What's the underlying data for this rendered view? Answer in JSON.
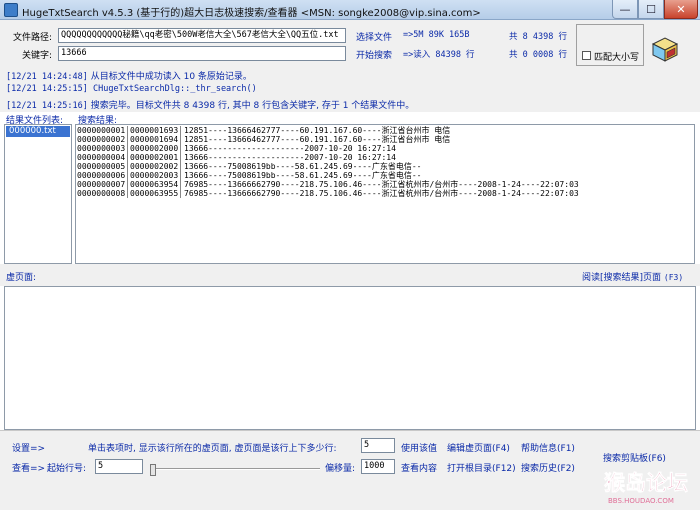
{
  "window": {
    "title": "HugeTxtSearch v4.5.3 (基于行的)超大日志极速搜索/查看器 <MSN: songke2008@vip.sina.com>",
    "min_label": "—",
    "max_label": "☐",
    "close_label": "✕"
  },
  "top": {
    "file_path_label": "文件路径:",
    "file_path_value": "QQQQQQQQQQQQ秘籍\\qq老密\\500W老信大全\\567老信大全\\QQ五位.txt",
    "keyword_label": "关键字:",
    "keyword_value": "13666",
    "select_file": "选择文件",
    "start_search": "开始搜索",
    "file_stat": "=>5M 89K 165B",
    "file_lines": "共 8 4398 行",
    "read_stat": "=>读入 84398 行",
    "found_lines": "共 0 0008 行",
    "case_label": "匹配大小写"
  },
  "log": [
    {
      "ts": "[12/21 14:24:48]",
      "msg": " 从目标文件中成功读入 10 条原始记录。"
    },
    {
      "ts": "[12/21 14:25:15]",
      "msg": " CHugeTxtSearchDlg::_thr_search()"
    },
    {
      "ts": "[12/21 14:25:16]",
      "msg": " 搜索完毕。目标文件共 8 4398 行, 其中 8 行包含关键字, 存于 1 个结果文件中。"
    }
  ],
  "lists": {
    "files_header": "结果文件列表:",
    "results_header": "搜索结果:",
    "files": [
      "000000.txt"
    ],
    "results": [
      {
        "a": "0000000001",
        "b": "0000001693",
        "text": "12851----13666462777----60.191.167.60----浙江省台州市 电信"
      },
      {
        "a": "0000000002",
        "b": "0000001694",
        "text": "12851----13666462777----60.191.167.60----浙江省台州市 电信"
      },
      {
        "a": "0000000003",
        "b": "0000002000",
        "text": "13666--------------------2007-10-20 16:27:14"
      },
      {
        "a": "0000000004",
        "b": "0000002001",
        "text": "13666--------------------2007-10-20 16:27:14"
      },
      {
        "a": "0000000005",
        "b": "0000002002",
        "text": "13666----75008619bb----58.61.245.69----广东省电信--"
      },
      {
        "a": "0000000006",
        "b": "0000002003",
        "text": "13666----75008619bb----58.61.245.69----广东省电信--"
      },
      {
        "a": "0000000007",
        "b": "0000063954",
        "text": "76985----13666662790----218.75.106.46----浙江省杭州市/台州市----2008-1-24----22:07:03"
      },
      {
        "a": "0000000008",
        "b": "0000063955",
        "text": "76985----13666662790----218.75.106.46----浙江省杭州市/台州市----2008-1-24----22:07:03"
      }
    ]
  },
  "viewer": {
    "label": "虚页面:",
    "read_link": "阅读[搜索结果]页面",
    "read_key": "(F3)"
  },
  "bottom": {
    "settings_label": "设置=>",
    "hint": "单击表项时, 显示该行所在的虚页面, 虚页面是该行上下多少行:",
    "lines_value": "5",
    "use_value": "使用该值",
    "edit_page": "编辑虚页面(F4)",
    "help": "帮助信息(F1)",
    "view_label": "查看=>",
    "start_line_label": "起始行号:",
    "start_line_value": "5",
    "offset_label": "偏移量:",
    "offset_value": "1000",
    "view_content": "查看内容",
    "open_dir": "打开根目录(F12)",
    "history": "搜索历史(F2)",
    "clipboard": "搜索剪贴板(F6)",
    "watermark": "猴岛论坛",
    "watermark_url": "BBS.HOUDAO.COM"
  }
}
